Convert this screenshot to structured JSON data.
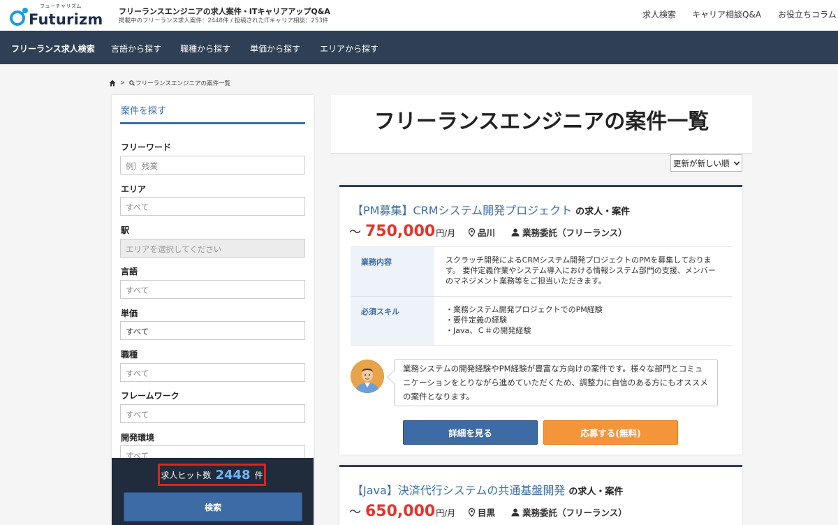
{
  "header": {
    "logo_ruby": "フューチャリズム",
    "logo_text": "Futurizm",
    "tagline": "フリーランスエンジニアの求人案件・ITキャリアアップQ&A",
    "subline": "掲載中のフリーランス求人案件：2448件 / 投稿されたITキャリア相談：253件",
    "nav": [
      "求人検索",
      "キャリア相談Q&A",
      "お役立ちコラム"
    ]
  },
  "navbar": {
    "items": [
      "フリーランス求人検索",
      "言語から探す",
      "職種から探す",
      "単価から探す",
      "エリアから探す"
    ]
  },
  "breadcrumb": {
    "current": "フリーランスエンジニアの案件一覧"
  },
  "sidebar": {
    "title": "案件を探す",
    "fields": [
      {
        "label": "フリーワード",
        "value": "例）残業"
      },
      {
        "label": "エリア",
        "value": "すべて"
      },
      {
        "label": "駅",
        "value": "エリアを選択してください"
      },
      {
        "label": "言語",
        "value": "すべて"
      },
      {
        "label": "単価",
        "value": "すべて"
      },
      {
        "label": "職種",
        "value": "すべて"
      },
      {
        "label": "フレームワーク",
        "value": "すべて"
      },
      {
        "label": "開発環境",
        "value": "すべて"
      }
    ],
    "hit_label": "求人ヒット数",
    "hit_count": "2448",
    "hit_unit": "件",
    "search_button": "検索"
  },
  "main": {
    "title": "フリーランスエンジニアの案件一覧",
    "sort_label": "更新が新しい順",
    "jobs": [
      {
        "title": "【PM募集】CRMシステム開発プロジェクト",
        "suffix": "の求人・案件",
        "tilde": "～",
        "salary": "750,000",
        "unit": "円/月",
        "location": "品川",
        "contract": "業務委託（フリーランス）",
        "details": [
          {
            "label": "業務内容",
            "text": "スクラッチ開発によるCRMシステム開発プロジェクトのPMを募集しております。 要件定義作業やシステム導入における情報システム部門の支援、メンバーのマネジメント業務等をご担当いただきます。"
          },
          {
            "label": "必須スキル",
            "lines": [
              "・業務システム開発プロジェクトでのPM経験",
              "・要件定義の経験",
              "・Java、Ｃ＃の開発経験"
            ]
          }
        ],
        "comment": "業務システムの開発経験やPM経験が豊富な方向けの案件です。様々な部門とコミュニケーションをとりながら進めていただくため、調整力に自信のある方にもオススメの案件となります。",
        "detail_button": "詳細を見る",
        "apply_button": "応募する(無料)"
      },
      {
        "title": "【Java】決済代行システムの共通基盤開発",
        "suffix": "の求人・案件",
        "tilde": "～",
        "salary": "650,000",
        "unit": "円/月",
        "location": "目黒",
        "contract": "業務委託（フリーランス）"
      }
    ]
  },
  "colors": {
    "navy": "#2f3f55",
    "link_blue": "#3a6ea5",
    "price_red": "#e8322a",
    "apply_orange": "#f5953a",
    "highlight_red": "#d9261c"
  }
}
